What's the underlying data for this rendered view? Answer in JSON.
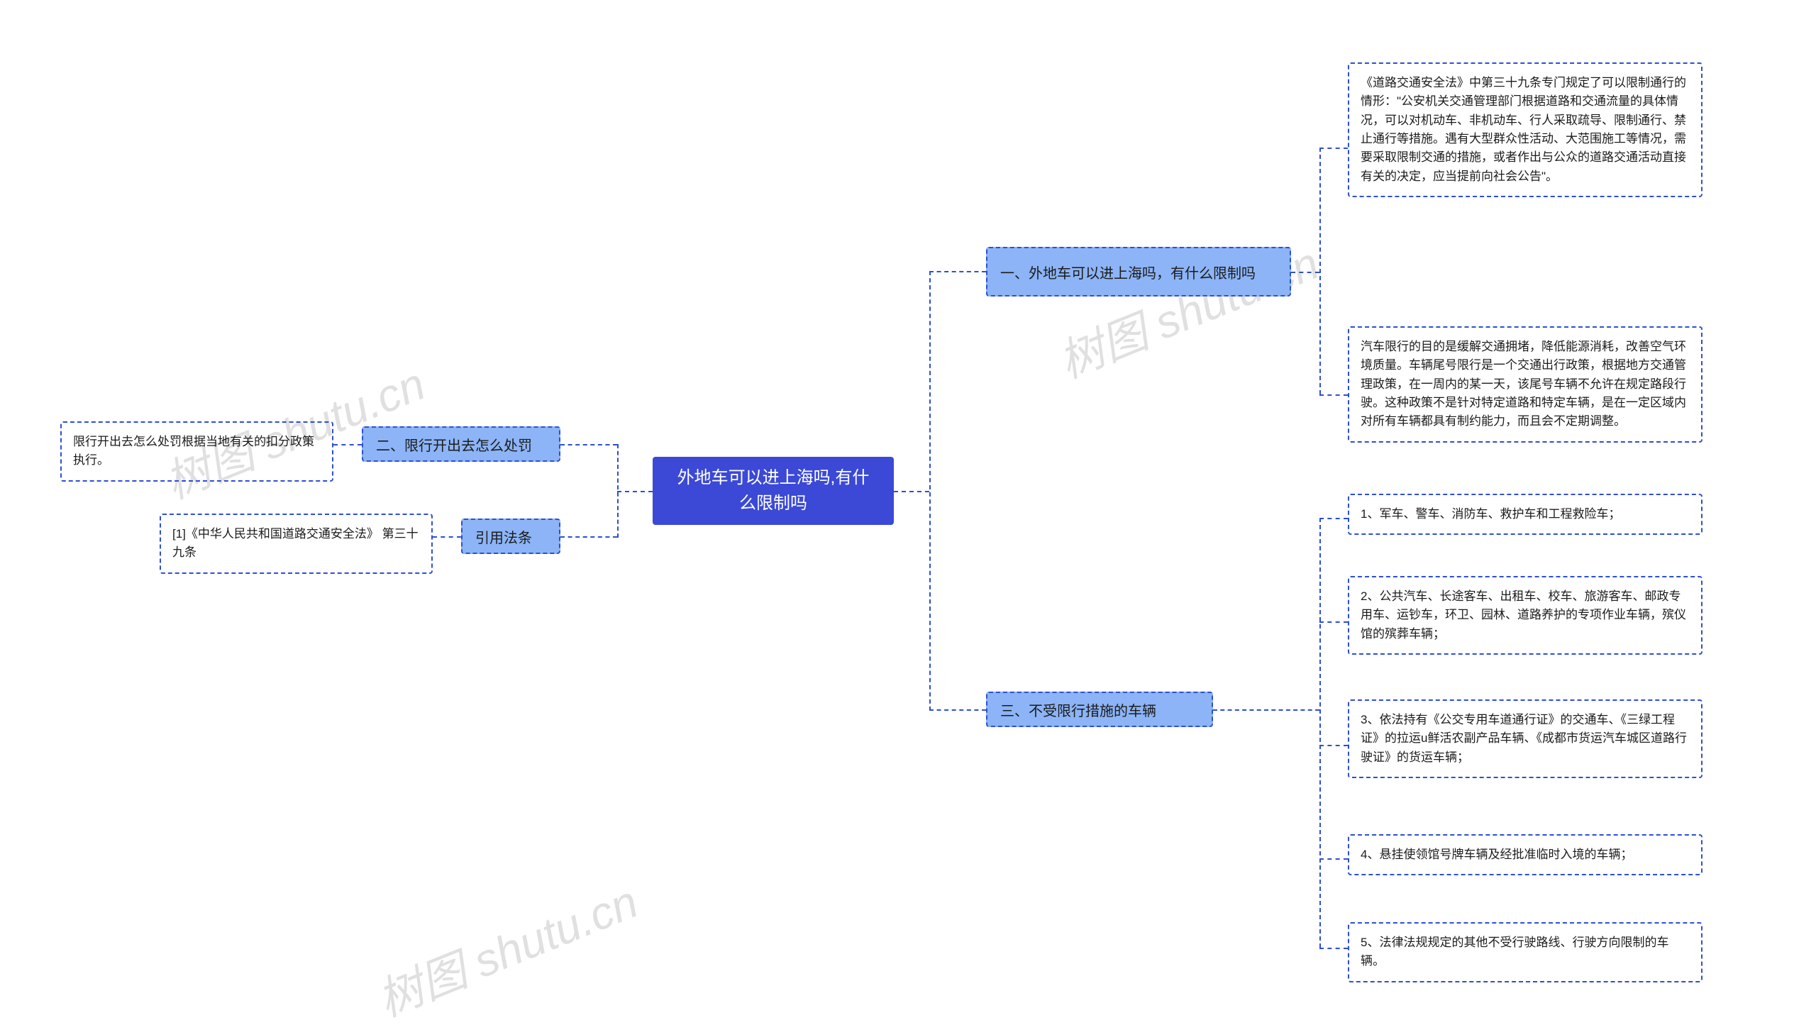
{
  "root": "外地车可以进上海吗,有什么限制吗",
  "right": {
    "sec1": {
      "title": "一、外地车可以进上海吗，有什么限制吗",
      "items": [
        "《道路交通安全法》中第三十九条专门规定了可以限制通行的情形：\"公安机关交通管理部门根据道路和交通流量的具体情况，可以对机动车、非机动车、行人采取疏导、限制通行、禁止通行等措施。遇有大型群众性活动、大范围施工等情况，需要采取限制交通的措施，或者作出与公众的道路交通活动直接有关的决定，应当提前向社会公告\"。",
        "汽车限行的目的是缓解交通拥堵，降低能源消耗，改善空气环境质量。车辆尾号限行是一个交通出行政策，根据地方交通管理政策，在一周内的某一天，该尾号车辆不允许在规定路段行驶。这种政策不是针对特定道路和特定车辆，是在一定区域内对所有车辆都具有制约能力，而且会不定期调整。"
      ]
    },
    "sec3": {
      "title": "三、不受限行措施的车辆",
      "items": [
        "1、军车、警车、消防车、救护车和工程救险车；",
        "2、公共汽车、长途客车、出租车、校车、旅游客车、邮政专用车、运钞车，环卫、园林、道路养护的专项作业车辆，殡仪馆的殡葬车辆；",
        "3、依法持有《公交专用车道通行证》的交通车、《三绿工程证》的拉运u鲜活农副产品车辆、《成都市货运汽车城区道路行驶证》的货运车辆；",
        "4、悬挂使领馆号牌车辆及经批准临时入境的车辆；",
        "5、法律法规规定的其他不受行驶路线、行驶方向限制的车辆。"
      ]
    }
  },
  "left": {
    "sec2": {
      "title": "二、限行开出去怎么处罚",
      "item": "限行开出去怎么处罚根据当地有关的扣分政策执行。"
    },
    "cite": {
      "title": "引用法条",
      "item": "[1]《中华人民共和国道路交通安全法》 第三十九条"
    }
  },
  "watermark": "树图 shutu.cn"
}
